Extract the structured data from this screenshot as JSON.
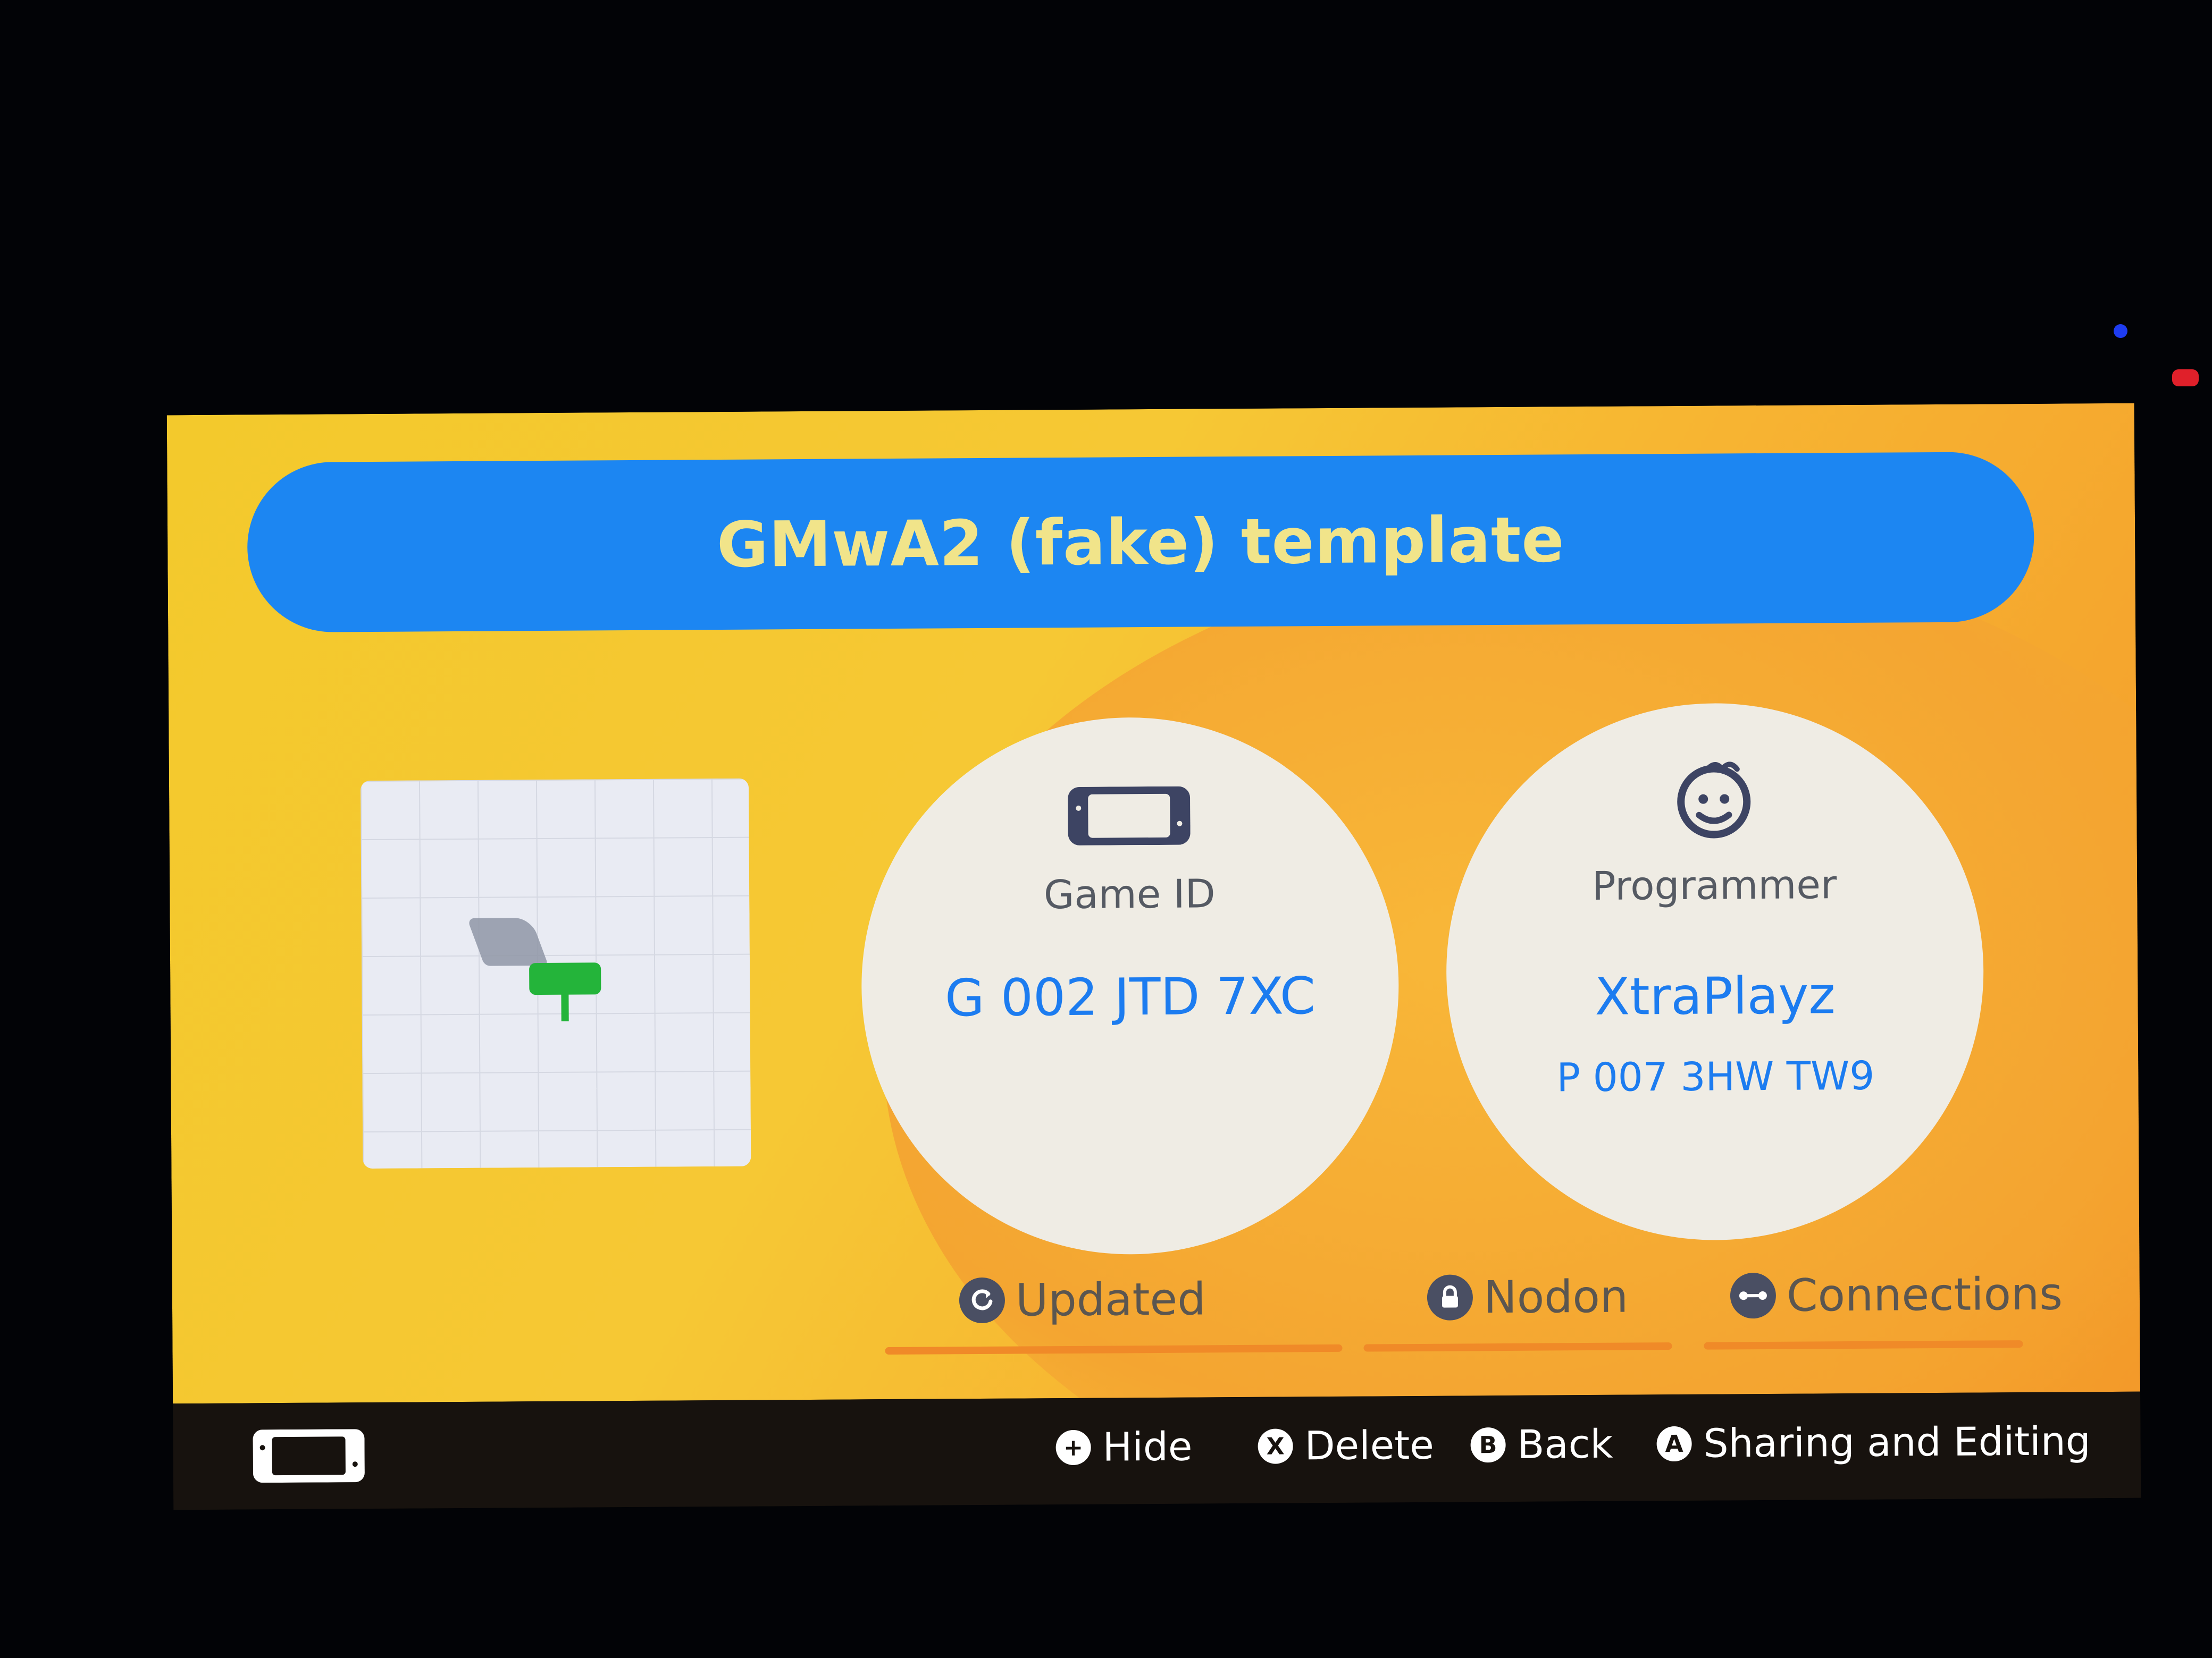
{
  "title": "GMwA2 (fake) template",
  "game_card": {
    "label": "Game ID",
    "value": "G 002 JTD 7XC",
    "icon": "switch-console-icon"
  },
  "programmer_card": {
    "label": "Programmer",
    "name": "XtraPlayz",
    "id": "P 007 3HW TW9",
    "icon": "smiley-face-icon"
  },
  "tabs": [
    {
      "label": "Updated",
      "icon": "refresh-icon"
    },
    {
      "label": "Nodon",
      "icon": "lock-icon"
    },
    {
      "label": "Connections",
      "icon": "link-icon"
    }
  ],
  "footer": {
    "hints": [
      {
        "button": "+",
        "label": "Hide"
      },
      {
        "button": "X",
        "label": "Delete"
      },
      {
        "button": "B",
        "label": "Back"
      },
      {
        "button": "A",
        "label": "Sharing and Editing"
      }
    ]
  },
  "colors": {
    "title_bar": "#1c86f2",
    "title_text": "#f1e48a",
    "accent_blue_text": "#1c7cf0",
    "panel_yellow": "#f3c92c",
    "tab_underline": "#f08a28"
  }
}
